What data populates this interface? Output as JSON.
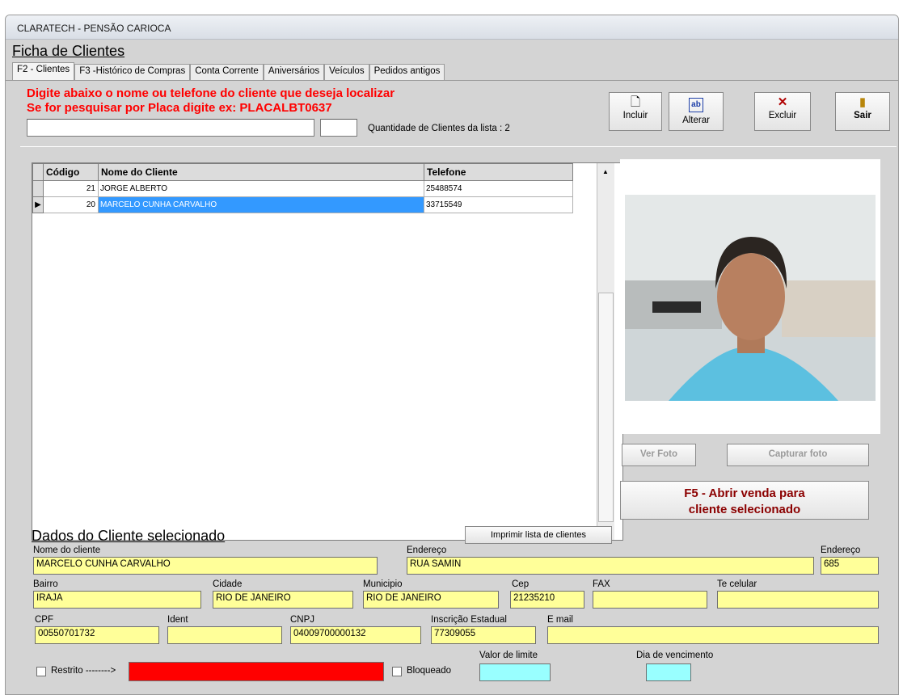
{
  "window": {
    "title": "CLARATECH - PENSÃO CARIOCA"
  },
  "page": {
    "heading": "Ficha de Clientes"
  },
  "tabs": [
    {
      "label": "F2 - Clientes"
    },
    {
      "label": "F3 -Histórico de Compras"
    },
    {
      "label": "Conta Corrente"
    },
    {
      "label": "Aniversários"
    },
    {
      "label": "Veículos"
    },
    {
      "label": "Pedidos antigos"
    }
  ],
  "search": {
    "instruction1": "Digite abaixo o nome ou telefone do cliente que deseja localizar",
    "instruction2": "Se for pesquisar por Placa digite ex: PLACALBT0637",
    "value": "",
    "count_text": "Quantidade de Clientes da lista : 2"
  },
  "toolbar": {
    "incluir": "Incluir",
    "alterar": "Alterar",
    "excluir": "Excluir",
    "sair": "Sair"
  },
  "grid": {
    "columns": [
      "Código",
      "Nome do Cliente",
      "Telefone"
    ],
    "rows": [
      {
        "codigo": "21",
        "nome": "JORGE ALBERTO",
        "telefone": "25488574"
      },
      {
        "codigo": "20",
        "nome": "MARCELO CUNHA CARVALHO",
        "telefone": "33715549"
      }
    ]
  },
  "photo_actions": {
    "ver_foto": "Ver Foto",
    "capturar_foto": "Capturar foto",
    "abrir_venda_line1": "F5 - Abrir venda para",
    "abrir_venda_line2": "cliente selecionado"
  },
  "details": {
    "heading": "Dados do Cliente selecionado",
    "print_button": "Imprimir lista de clientes",
    "nome_label": "Nome do cliente",
    "nome": "MARCELO CUNHA CARVALHO",
    "endereco_label": "Endereço",
    "endereco": "RUA SAMIN",
    "numero_label": "Endereço",
    "numero": "685",
    "bairro_label": "Bairro",
    "bairro": "IRAJA",
    "cidade_label": "Cidade",
    "cidade": "RIO DE JANEIRO",
    "municipio_label": "Municipio",
    "municipio": "RIO DE JANEIRO",
    "cep_label": "Cep",
    "cep": "21235210",
    "fax_label": "FAX",
    "fax": "",
    "celular_label": "Te celular",
    "celular": "",
    "cpf_label": "CPF",
    "cpf": "00550701732",
    "ident_label": "Ident",
    "ident": "",
    "cnpj_label": "CNPJ",
    "cnpj": "04009700000132",
    "ie_label": "Inscrição Estadual",
    "ie": "77309055",
    "email_label": "E mail",
    "email": "",
    "restrito_label": "Restrito -------->",
    "bloqueado_label": "Bloqueado",
    "limite_label": "Valor de limite",
    "vencimento_label": "Dia de vencimento"
  },
  "colors": {
    "instruction_red": "#ff0000",
    "field_yellow": "#ffff99",
    "field_cyan": "#99ffff",
    "restrito_red": "#ff0000",
    "selection_blue": "#3399ff",
    "f5_text": "#8b0000"
  }
}
